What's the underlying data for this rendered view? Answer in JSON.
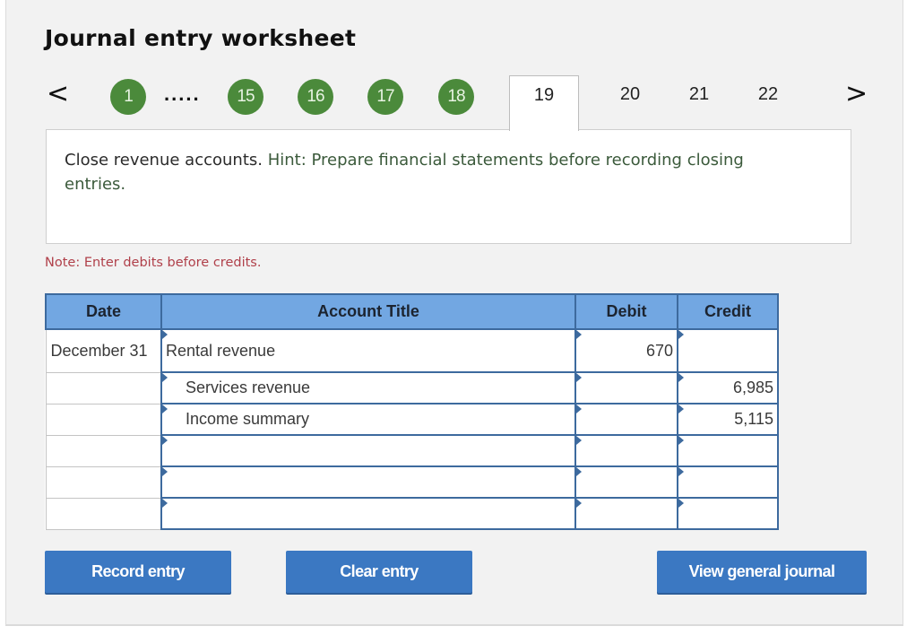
{
  "title": "Journal entry worksheet",
  "nav": {
    "prev_icon": "chevron-left-icon",
    "next_icon": "chevron-right-icon",
    "prev_glyph": "<",
    "next_glyph": ">",
    "completed": [
      "1",
      "15",
      "16",
      "17",
      "18"
    ],
    "ellipsis": ".....",
    "active": "19",
    "upcoming": [
      "20",
      "21",
      "22"
    ],
    "completed_color": "#4b8a3b"
  },
  "question": {
    "text": "Close revenue accounts.",
    "hint": "Hint: Prepare financial statements before recording closing entries."
  },
  "note": "Note: Enter debits before credits.",
  "table": {
    "headers": [
      "Date",
      "Account Title",
      "Debit",
      "Credit"
    ],
    "rows": [
      {
        "date": "December 31",
        "account": "Rental revenue",
        "debit": "670",
        "credit": ""
      },
      {
        "date": "",
        "account": "Services revenue",
        "debit": "",
        "credit": "6,985"
      },
      {
        "date": "",
        "account": "Income summary",
        "debit": "",
        "credit": "5,115"
      },
      {
        "date": "",
        "account": "",
        "debit": "",
        "credit": ""
      },
      {
        "date": "",
        "account": "",
        "debit": "",
        "credit": ""
      },
      {
        "date": "",
        "account": "",
        "debit": "",
        "credit": ""
      }
    ],
    "header_color": "#72a7e2"
  },
  "buttons": {
    "record": "Record entry",
    "clear": "Clear entry",
    "view": "View general journal",
    "color": "#3b78c2"
  }
}
